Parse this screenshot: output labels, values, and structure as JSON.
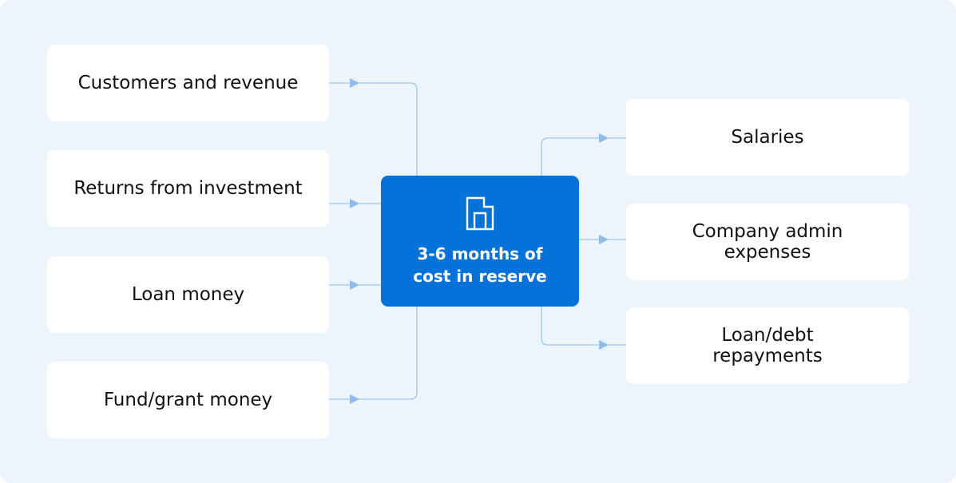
{
  "diagram": {
    "center": {
      "title": "3-6 months of\ncost in reserve",
      "icon": "building-icon"
    },
    "sources": [
      {
        "label": "Customers and revenue"
      },
      {
        "label": "Returns from investment"
      },
      {
        "label": "Loan money"
      },
      {
        "label": "Fund/grant money"
      }
    ],
    "uses": [
      {
        "label": "Salaries"
      },
      {
        "label": "Company admin\nexpenses"
      },
      {
        "label": "Loan/debt\nrepayments"
      }
    ],
    "colors": {
      "background": "#eef4fb",
      "box": "#ffffff",
      "center": "#0572d9",
      "connector": "#9cc5ee",
      "arrow": "#8dbdec"
    }
  }
}
